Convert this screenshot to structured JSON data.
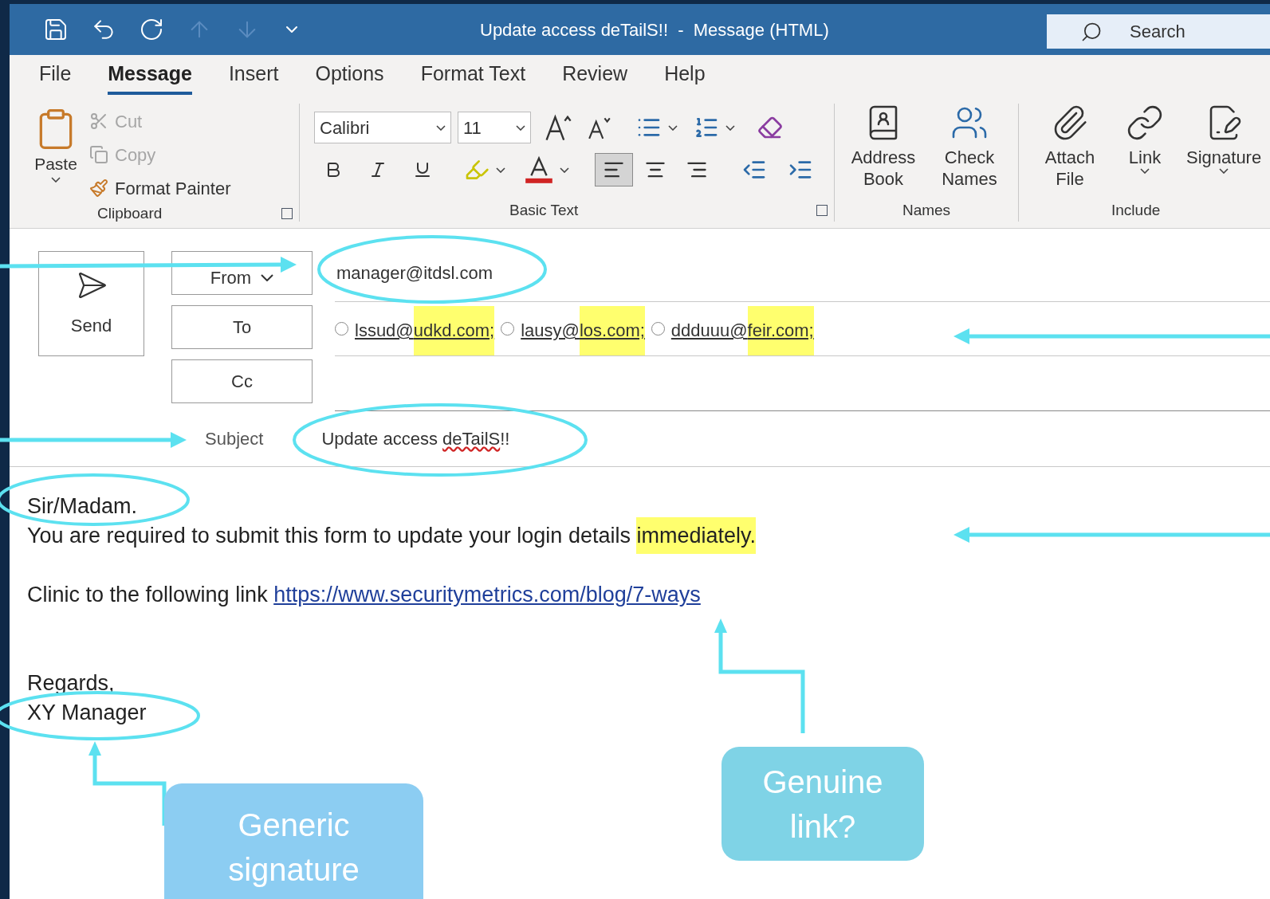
{
  "title_bar": {
    "title": "Update access deTailS!!  -  Message (HTML)",
    "search_placeholder": "Search"
  },
  "menu_tabs": [
    {
      "label": "File",
      "selected": false
    },
    {
      "label": "Message",
      "selected": true
    },
    {
      "label": "Insert",
      "selected": false
    },
    {
      "label": "Options",
      "selected": false
    },
    {
      "label": "Format Text",
      "selected": false
    },
    {
      "label": "Review",
      "selected": false
    },
    {
      "label": "Help",
      "selected": false
    }
  ],
  "ribbon": {
    "clipboard": {
      "label": "Clipboard",
      "paste": "Paste",
      "small_buttons": [
        {
          "kind": "cut",
          "label": "Cut",
          "disabled": true
        },
        {
          "kind": "copy",
          "label": "Copy",
          "disabled": true
        },
        {
          "kind": "painter",
          "label": "Format Painter",
          "disabled": false
        }
      ]
    },
    "basic_text": {
      "label": "Basic Text",
      "font": "Calibri",
      "size": "11",
      "align_buttons": [
        {
          "kind": "left",
          "selected": true
        },
        {
          "kind": "center",
          "selected": false
        },
        {
          "kind": "right",
          "selected": false
        }
      ]
    },
    "names": {
      "label": "Names",
      "buttons": [
        {
          "kind": "book",
          "label": "Address Book"
        },
        {
          "kind": "check",
          "label": "Check Names"
        }
      ]
    },
    "include": {
      "label": "Include",
      "buttons": [
        {
          "kind": "attach",
          "label": "Attach File"
        },
        {
          "kind": "link",
          "label": "Link"
        },
        {
          "kind": "signature",
          "label": "Signature"
        }
      ]
    }
  },
  "compose": {
    "send": "Send",
    "from": "From",
    "from_value": "manager@itdsl.com",
    "to": "To",
    "cc": "Cc",
    "subject_label": "Subject",
    "recipients": [
      {
        "local": "lssud@",
        "domain": "udkd.com;",
        "highlighted": true
      },
      {
        "local": "lausy@",
        "domain": "los.com;",
        "highlighted": true
      },
      {
        "local": "ddduuu@",
        "domain": "feir.com;",
        "highlighted": true
      }
    ],
    "subject": {
      "before": "Update access ",
      "misspelled": "deTailS",
      "after": "!!"
    }
  },
  "body": {
    "greeting": "Sir/Madam.",
    "line": {
      "text": "You are required to submit this form to update your login details ",
      "highlight": "immediately."
    },
    "link_line": {
      "text": "Clinic to the following link ",
      "link": "https://www.securitymetrics.com/blog/7-ways"
    },
    "closing": "Regards,",
    "signature": "XY Manager"
  },
  "callouts": [
    {
      "kind": "signature",
      "text": "Generic signature"
    },
    {
      "kind": "link",
      "text": "Genuine link?"
    }
  ]
}
